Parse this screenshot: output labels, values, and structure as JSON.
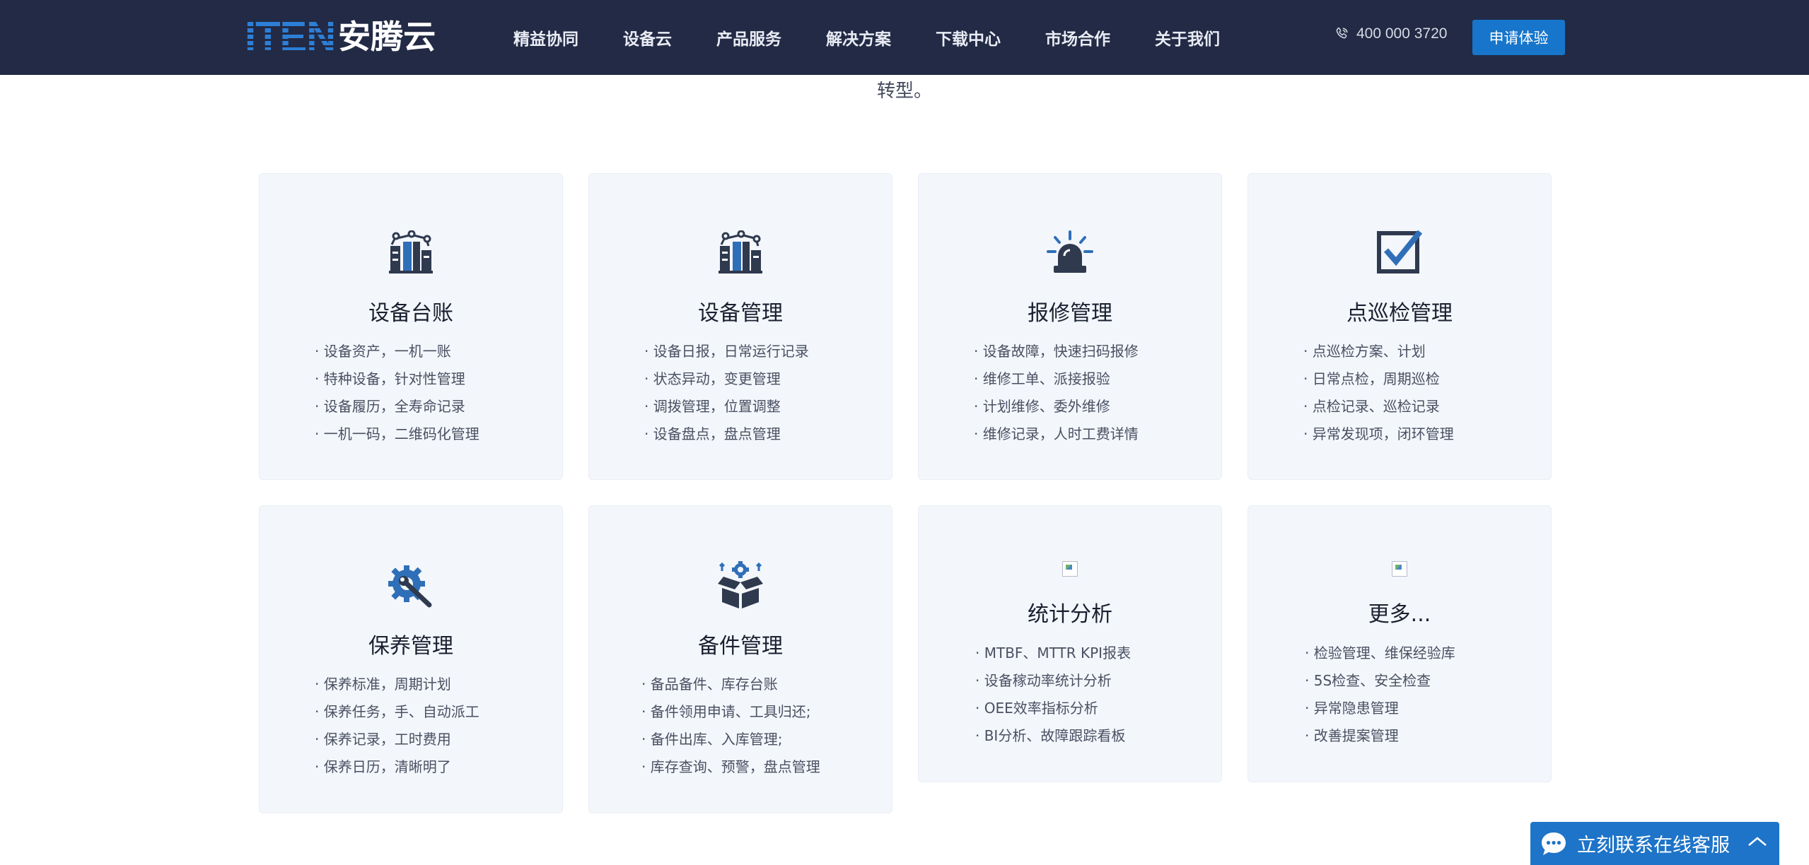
{
  "header": {
    "logo_text": "ITEN",
    "logo_cn": "安腾云",
    "nav": [
      "精益协同",
      "设备云",
      "产品服务",
      "解决方案",
      "下载中心",
      "市场合作",
      "关于我们"
    ],
    "phone": "400 000 3720",
    "apply_label": "申请体验"
  },
  "intro": {
    "tail": "转型。"
  },
  "cards": [
    {
      "title": "设备台账",
      "icon": "equipment-icon",
      "items": [
        "· 设备资产，一机一账",
        "· 特种设备，针对性管理",
        "· 设备履历，全寿命记录",
        "· 一机一码，二维码化管理"
      ]
    },
    {
      "title": "设备管理",
      "icon": "equipment-icon",
      "items": [
        "· 设备日报，日常运行记录",
        "· 状态异动，变更管理",
        "· 调拨管理，位置调整",
        "· 设备盘点，盘点管理"
      ]
    },
    {
      "title": "报修管理",
      "icon": "alarm-icon",
      "items": [
        "· 设备故障，快速扫码报修",
        "· 维修工单、派接报验",
        "· 计划维修、委外维修",
        "· 维修记录，人时工费详情"
      ]
    },
    {
      "title": "点巡检管理",
      "icon": "checkbox-icon",
      "items": [
        "· 点巡检方案、计划",
        "· 日常点检，周期巡检",
        "· 点检记录、巡检记录",
        "· 异常发现项，闭环管理"
      ]
    },
    {
      "title": "保养管理",
      "icon": "gear-wrench-icon",
      "items": [
        "· 保养标准，周期计划",
        "· 保养任务，手、自动派工",
        "· 保养记录，工时费用",
        "· 保养日历，清晰明了"
      ]
    },
    {
      "title": "备件管理",
      "icon": "parts-box-icon",
      "items": [
        "· 备品备件、库存台账",
        "· 备件领用申请、工具归还;",
        "· 备件出库、入库管理;",
        "· 库存查询、预警，盘点管理"
      ]
    },
    {
      "title": "统计分析",
      "icon": "broken-image-icon",
      "items": [
        "· MTBF、MTTR KPI报表",
        "· 设备稼动率统计分析",
        "· OEE效率指标分析",
        "· BI分析、故障跟踪看板"
      ]
    },
    {
      "title": "更多...",
      "icon": "broken-image-icon",
      "items": [
        "· 检验管理、维保经验库",
        "· 5S检查、安全检查",
        "· 异常隐患管理",
        "· 改善提案管理"
      ]
    }
  ],
  "chat": {
    "label": "立刻联系在线客服"
  },
  "colors": {
    "header_bg": "#222a45",
    "accent": "#1776cb",
    "card_bg": "#f3f6fb",
    "icon_dark": "#2f3a4f",
    "icon_blue": "#2f6fb8"
  }
}
